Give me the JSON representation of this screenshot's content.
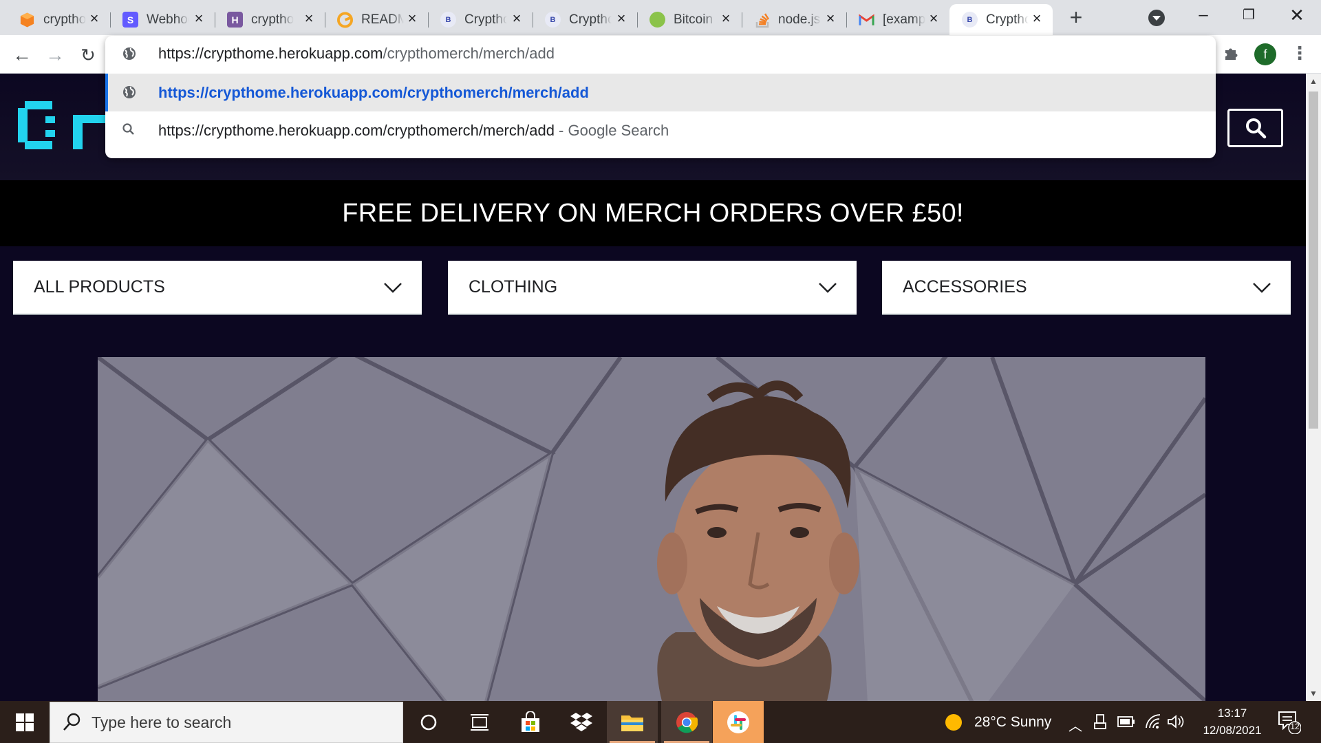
{
  "browser": {
    "tabs": [
      {
        "title": "crypthome",
        "favicon": "orange-cube-icon",
        "left": 0
      },
      {
        "title": "Webhooks",
        "favicon": "stripe-s-icon",
        "left": 0
      },
      {
        "title": "crypthome",
        "favicon": "heroku-h-icon",
        "left": 0
      },
      {
        "title": "README",
        "favicon": "readme-icon",
        "left": 0
      },
      {
        "title": "Crypthome",
        "favicon": "crypthome-b-icon",
        "left": 0
      },
      {
        "title": "Crypthome",
        "favicon": "crypthome-b-icon",
        "left": 0
      },
      {
        "title": "Bitcoin",
        "favicon": "bitcoin-leaf-icon",
        "left": 0
      },
      {
        "title": "node.js",
        "favicon": "stackoverflow-icon",
        "left": 0
      },
      {
        "title": "[example",
        "favicon": "gmail-icon",
        "left": 0
      },
      {
        "title": "Crypthome",
        "favicon": "crypthome-b-icon",
        "left": 0,
        "active": true
      }
    ],
    "new_tab_label": "+",
    "profile_initial": "f"
  },
  "omnibox": {
    "typed_url_host": "https://crypthome.herokuapp.com",
    "typed_url_path": "/crypthomerch/merch/add",
    "suggestion_url": "https://crypthome.herokuapp.com/crypthomerch/merch/add",
    "suggestion_search": "https://crypthome.herokuapp.com/crypthomerch/merch/add",
    "suggestion_search_suffix": " - Google Search"
  },
  "site": {
    "banner": "FREE DELIVERY ON MERCH ORDERS OVER £50!",
    "categories": [
      "ALL PRODUCTS",
      "CLOTHING",
      "ACCESSORIES"
    ],
    "logo_color": "#22d3ee"
  },
  "taskbar": {
    "search_placeholder": "Type here to search",
    "weather": "28°C  Sunny",
    "time": "13:17",
    "date": "12/08/2021",
    "notification_count": "12"
  }
}
